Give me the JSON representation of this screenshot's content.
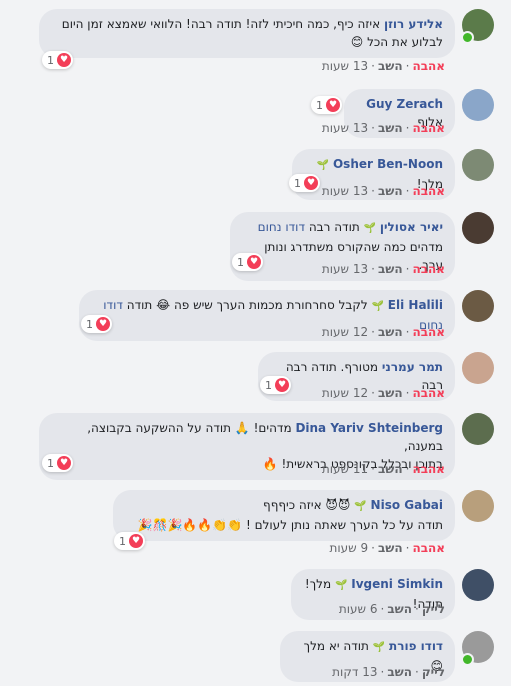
{
  "comments": [
    {
      "name": "אלידע רוזן",
      "badge": "",
      "text1": "איזה כיף, כמה חיכיתי לזה! תודה רבה! הלוואי שאמצא זמן היום",
      "text2": "לבלוע את הכל 😊",
      "react_count": "1",
      "action": "אהבה",
      "reply": "השב",
      "time": "13 שעות",
      "avatar": "#5b7b4a",
      "online": true
    },
    {
      "name": "Guy Zerach",
      "text1": "אלוף",
      "react_count": "1",
      "action": "אהבה",
      "reply": "השב",
      "time": "13 שעות",
      "avatar": "#8aa6c9"
    },
    {
      "name": "Osher Ben-Noon",
      "text1": "מלך!",
      "react_count": "1",
      "action": "אהבה",
      "reply": "השב",
      "time": "13 שעות",
      "avatar": "#7d8a74"
    },
    {
      "name": "יאיר אסולין",
      "tag": "דודו נחום",
      "text1": "תודה רבה",
      "text2": "מדהים כמה שהקורס משתדרג ונותן ערך.",
      "react_count": "1",
      "action": "אהבה",
      "reply": "השב",
      "time": "13 שעות",
      "avatar": "#4a3b32"
    },
    {
      "name": "Eli Halili",
      "tag": "דודו נחום",
      "text1": "לקבל סחרחורת מכמות הערך שיש פה 😂 תודה",
      "react_count": "1",
      "action": "אהבה",
      "reply": "השב",
      "time": "12 שעות",
      "avatar": "#6b5a44"
    },
    {
      "name": "תמר עמרני",
      "text1": "מטורף. תודה רבה רבה",
      "react_count": "1",
      "action": "אהבה",
      "reply": "השב",
      "time": "12 שעות",
      "avatar": "#c9a48f"
    },
    {
      "name": "Dina Yariv Shteinberg",
      "text1": "מדהים! 🙏 תודה על ההשקעה בקבוצה, במענה,",
      "text2": "בתוכן ובכלל בקונספט בראשית! 🔥",
      "react_count": "1",
      "action": "אהבה",
      "reply": "השב",
      "time": "11 שעות",
      "avatar": "#5c6d4e"
    },
    {
      "name": "Niso Gabai",
      "text1": "😈😈 איזה כיףףף",
      "text2": "תודה על כל הערך שאתה נותן לעולם ! 👏👏🔥🔥🎉🎊🎉",
      "react_count": "1",
      "action": "אהבה",
      "reply": "השב",
      "time": "9 שעות",
      "avatar": "#b89f7c"
    },
    {
      "name": "Ivgeni Simkin",
      "text1": "מלך! תודה!",
      "action": "לייק",
      "reply": "השב",
      "time": "6 שעות",
      "avatar": "#3f4f66"
    },
    {
      "name": "דודו פורת",
      "text1": "תודה יא מלך 😊",
      "action": "לייק",
      "reply": "השב",
      "time": "13 דקות",
      "avatar": "#9a9a9a",
      "online": true
    }
  ],
  "colors": {
    "link": "#385898",
    "love": "#f33e58",
    "bubble": "#e4e6eb"
  }
}
